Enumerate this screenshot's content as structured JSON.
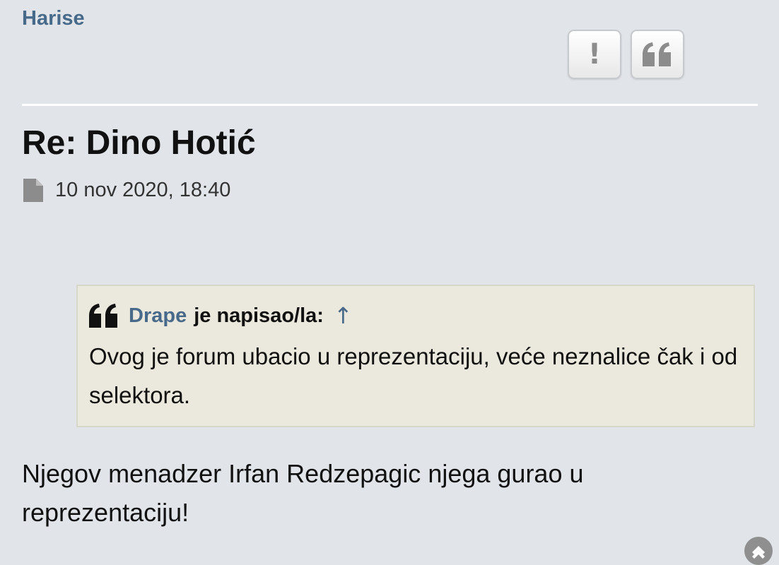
{
  "post": {
    "author": "Harise",
    "title": "Re: Dino Hotić",
    "date": "10 nov 2020, 18:40",
    "body": "Njegov menadzer Irfan Redzepagic njega gurao u reprezentaciju!"
  },
  "buttons": {
    "report_label": "!",
    "report_icon": "exclamation-icon",
    "quote_icon": "quote-icon"
  },
  "quote": {
    "author": "Drape",
    "wrote_text": "je napisao/la:",
    "arrow": "↑",
    "text": "Ovog je forum ubacio u reprezentaciju, veće neznalice čak i od selektora."
  },
  "colors": {
    "background": "#e1e4e8",
    "link": "#47698a",
    "quote_background": "#ebe9dd",
    "quote_border": "#d6d8c9",
    "scroll_button": "#8f8f8f"
  },
  "icons": {
    "post_icon": "file-icon",
    "scroll_top": "chevron-up-circle-icon"
  }
}
